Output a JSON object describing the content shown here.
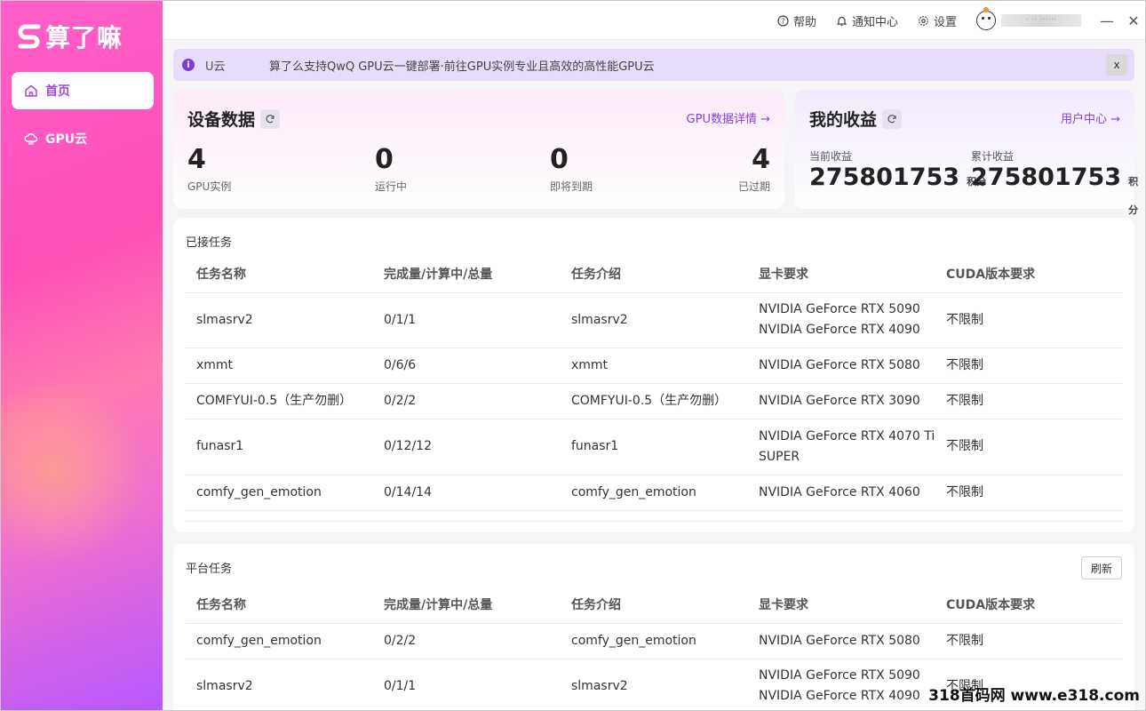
{
  "app": {
    "logo_text": "算了嘛"
  },
  "sidebar": {
    "items": [
      {
        "label": "首页",
        "icon": "home-icon",
        "active": true
      },
      {
        "label": "GPU云",
        "icon": "cloud-icon",
        "active": false
      }
    ]
  },
  "topbar": {
    "help": "帮助",
    "notify": "通知中心",
    "settings": "设置",
    "username": "· ·· ······",
    "minimize": "—",
    "close": "✕"
  },
  "notice": {
    "tag": "U云",
    "text": "算了么支持QwQ GPU云一键部署·前往GPU实例专业且高效的高性能GPU云",
    "close": "x"
  },
  "device": {
    "title": "设备数据",
    "link": "GPU数据详情 →",
    "stats": [
      {
        "value": "4",
        "label": "GPU实例"
      },
      {
        "value": "0",
        "label": "运行中"
      },
      {
        "value": "0",
        "label": "即将到期"
      },
      {
        "value": "4",
        "label": "已过期"
      }
    ]
  },
  "earnings": {
    "title": "我的收益",
    "link": "用户中心 →",
    "current_label": "当前收益",
    "current_value": "275801753",
    "total_label": "累计收益",
    "total_value": "275801753",
    "unit": "积分"
  },
  "accepted_tasks": {
    "title": "已接任务",
    "columns": [
      "任务名称",
      "完成量/计算中/总量",
      "任务介绍",
      "显卡要求",
      "CUDA版本要求"
    ],
    "rows": [
      [
        "slmasrv2",
        "0/1/1",
        "slmasrv2",
        "NVIDIA GeForce RTX 5090\nNVIDIA GeForce RTX 4090",
        "不限制"
      ],
      [
        "xmmt",
        "0/6/6",
        "xmmt",
        "NVIDIA GeForce RTX 5080",
        "不限制"
      ],
      [
        "COMFYUI-0.5（生产勿删）",
        "0/2/2",
        "COMFYUI-0.5（生产勿删）",
        "NVIDIA GeForce RTX 3090",
        "不限制"
      ],
      [
        "funasr1",
        "0/12/12",
        "funasr1",
        "NVIDIA GeForce RTX 4070 Ti\nSUPER",
        "不限制"
      ],
      [
        "comfy_gen_emotion",
        "0/14/14",
        "comfy_gen_emotion",
        "NVIDIA GeForce RTX 4060",
        "不限制"
      ]
    ]
  },
  "platform_tasks": {
    "title": "平台任务",
    "refresh": "刷新",
    "columns": [
      "任务名称",
      "完成量/计算中/总量",
      "任务介绍",
      "显卡要求",
      "CUDA版本要求"
    ],
    "rows": [
      [
        "comfy_gen_emotion",
        "0/2/2",
        "comfy_gen_emotion",
        "NVIDIA GeForce RTX 5080",
        "不限制"
      ],
      [
        "slmasrv2",
        "0/1/1",
        "slmasrv2",
        "NVIDIA GeForce RTX 5090\nNVIDIA GeForce RTX 4090",
        "不限制"
      ]
    ]
  },
  "watermark": "318首码网 www.e318.com",
  "colors": {
    "accent": "#8a3ee0",
    "sidebar_top": "#ff5fc9",
    "sidebar_bottom": "#b657ff",
    "notice_bg": "#e8dcfb"
  }
}
